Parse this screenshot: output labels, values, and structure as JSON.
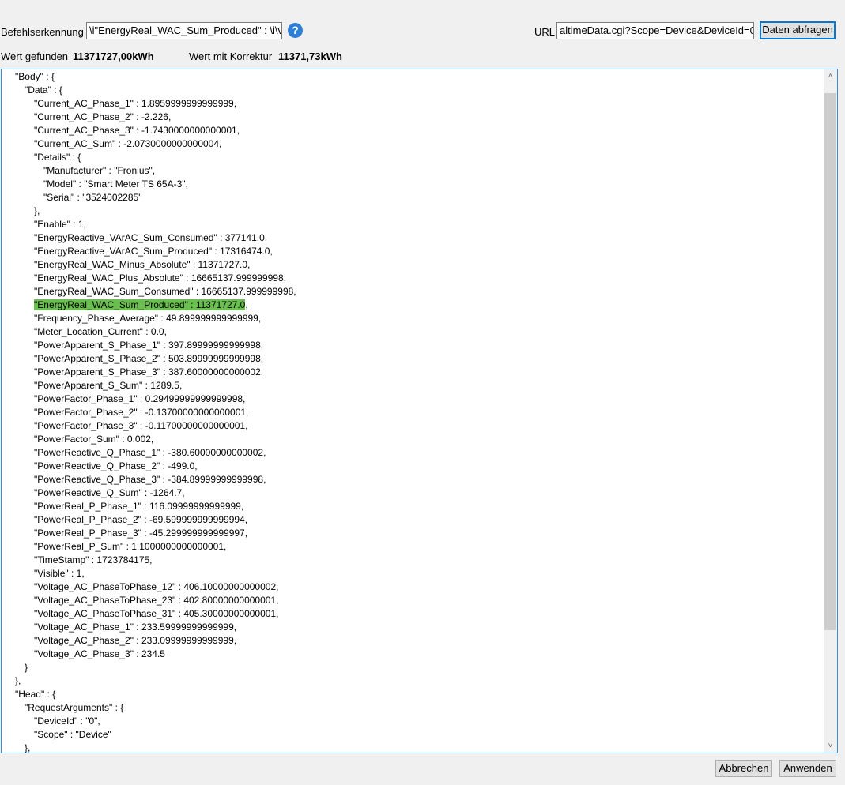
{
  "header": {
    "command_label": "Befehlserkennung",
    "command_value": "\\i\"EnergyReal_WAC_Sum_Produced\" : \\i\\v",
    "help_icon": "?",
    "url_label": "URL",
    "url_value": "altimeData.cgi?Scope=Device&DeviceId=0",
    "fetch_button": "Daten abfragen"
  },
  "results": {
    "found_label": "Wert gefunden",
    "found_value": "11371727,00kWh",
    "corrected_label": "Wert mit Korrektur",
    "corrected_value": "11371,73kWh"
  },
  "highlight_index": 17,
  "lines": [
    [
      1,
      "\"Body\" : {"
    ],
    [
      2,
      "\"Data\" : {"
    ],
    [
      3,
      "\"Current_AC_Phase_1\" : 1.8959999999999999,"
    ],
    [
      3,
      "\"Current_AC_Phase_2\" : -2.226,"
    ],
    [
      3,
      "\"Current_AC_Phase_3\" : -1.7430000000000001,"
    ],
    [
      3,
      "\"Current_AC_Sum\" : -2.0730000000000004,"
    ],
    [
      3,
      "\"Details\" : {"
    ],
    [
      4,
      "\"Manufacturer\" : \"Fronius\","
    ],
    [
      4,
      "\"Model\" : \"Smart Meter TS 65A-3\","
    ],
    [
      4,
      "\"Serial\" : \"3524002285\""
    ],
    [
      3,
      "},"
    ],
    [
      3,
      "\"Enable\" : 1,"
    ],
    [
      3,
      "\"EnergyReactive_VArAC_Sum_Consumed\" : 377141.0,"
    ],
    [
      3,
      "\"EnergyReactive_VArAC_Sum_Produced\" : 17316474.0,"
    ],
    [
      3,
      "\"EnergyReal_WAC_Minus_Absolute\" : 11371727.0,"
    ],
    [
      3,
      "\"EnergyReal_WAC_Plus_Absolute\" : 16665137.999999998,"
    ],
    [
      3,
      "\"EnergyReal_WAC_Sum_Consumed\" : 16665137.999999998,"
    ],
    [
      3,
      "\"EnergyReal_WAC_Sum_Produced\" : 11371727.0",
      ","
    ],
    [
      3,
      "\"Frequency_Phase_Average\" : 49.899999999999999,"
    ],
    [
      3,
      "\"Meter_Location_Current\" : 0.0,"
    ],
    [
      3,
      "\"PowerApparent_S_Phase_1\" : 397.89999999999998,"
    ],
    [
      3,
      "\"PowerApparent_S_Phase_2\" : 503.89999999999998,"
    ],
    [
      3,
      "\"PowerApparent_S_Phase_3\" : 387.60000000000002,"
    ],
    [
      3,
      "\"PowerApparent_S_Sum\" : 1289.5,"
    ],
    [
      3,
      "\"PowerFactor_Phase_1\" : 0.29499999999999998,"
    ],
    [
      3,
      "\"PowerFactor_Phase_2\" : -0.13700000000000001,"
    ],
    [
      3,
      "\"PowerFactor_Phase_3\" : -0.11700000000000001,"
    ],
    [
      3,
      "\"PowerFactor_Sum\" : 0.002,"
    ],
    [
      3,
      "\"PowerReactive_Q_Phase_1\" : -380.60000000000002,"
    ],
    [
      3,
      "\"PowerReactive_Q_Phase_2\" : -499.0,"
    ],
    [
      3,
      "\"PowerReactive_Q_Phase_3\" : -384.89999999999998,"
    ],
    [
      3,
      "\"PowerReactive_Q_Sum\" : -1264.7,"
    ],
    [
      3,
      "\"PowerReal_P_Phase_1\" : 116.09999999999999,"
    ],
    [
      3,
      "\"PowerReal_P_Phase_2\" : -69.599999999999994,"
    ],
    [
      3,
      "\"PowerReal_P_Phase_3\" : -45.299999999999997,"
    ],
    [
      3,
      "\"PowerReal_P_Sum\" : 1.1000000000000001,"
    ],
    [
      3,
      "\"TimeStamp\" : 1723784175,"
    ],
    [
      3,
      "\"Visible\" : 1,"
    ],
    [
      3,
      "\"Voltage_AC_PhaseToPhase_12\" : 406.10000000000002,"
    ],
    [
      3,
      "\"Voltage_AC_PhaseToPhase_23\" : 402.80000000000001,"
    ],
    [
      3,
      "\"Voltage_AC_PhaseToPhase_31\" : 405.30000000000001,"
    ],
    [
      3,
      "\"Voltage_AC_Phase_1\" : 233.59999999999999,"
    ],
    [
      3,
      "\"Voltage_AC_Phase_2\" : 233.09999999999999,"
    ],
    [
      3,
      "\"Voltage_AC_Phase_3\" : 234.5"
    ],
    [
      2,
      "}"
    ],
    [
      1,
      "},"
    ],
    [
      1,
      "\"Head\" : {"
    ],
    [
      2,
      "\"RequestArguments\" : {"
    ],
    [
      3,
      "\"DeviceId\" : \"0\","
    ],
    [
      3,
      "\"Scope\" : \"Device\""
    ],
    [
      2,
      "},"
    ]
  ],
  "footer": {
    "cancel": "Abbrechen",
    "apply": "Anwenden"
  }
}
